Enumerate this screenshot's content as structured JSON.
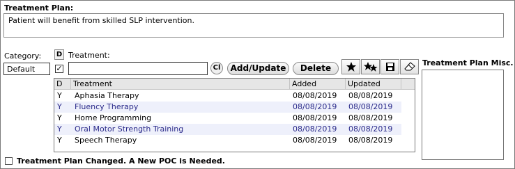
{
  "treatment_plan": {
    "label": "Treatment Plan:",
    "text": "Patient will benefit from skilled SLP intervention."
  },
  "category": {
    "label": "Category:",
    "value": "Default"
  },
  "d_button": "D",
  "default_checked": "✓",
  "treatment": {
    "label": "Treatment:",
    "value": ""
  },
  "buttons": {
    "cl": "Cl",
    "add_update": "Add/Update",
    "delete": "Delete"
  },
  "toolbar_icons": [
    "star-icon",
    "double-star-icon",
    "save-icon",
    "eraser-icon"
  ],
  "grid": {
    "headers": [
      "D",
      "Treatment",
      "Added",
      "Updated"
    ],
    "rows": [
      {
        "d": "Y",
        "treatment": "Aphasia Therapy",
        "added": "08/08/2019",
        "updated": "08/08/2019"
      },
      {
        "d": "Y",
        "treatment": "Fluency Therapy",
        "added": "08/08/2019",
        "updated": "08/08/2019"
      },
      {
        "d": "Y",
        "treatment": "Home Programming",
        "added": "08/08/2019",
        "updated": "08/08/2019"
      },
      {
        "d": "Y",
        "treatment": "Oral Motor Strength Training",
        "added": "08/08/2019",
        "updated": "08/08/2019"
      },
      {
        "d": "Y",
        "treatment": "Speech Therapy",
        "added": "08/08/2019",
        "updated": "08/08/2019"
      }
    ]
  },
  "misc": {
    "label": "Treatment Plan Misc."
  },
  "poc_checkbox": {
    "label": "Treatment Plan Changed. A New POC is Needed."
  },
  "colors": {
    "alt_row": "#eef0fb",
    "header_bg": "#e6e6e6",
    "row_text_blue": "#2a2a8a"
  }
}
